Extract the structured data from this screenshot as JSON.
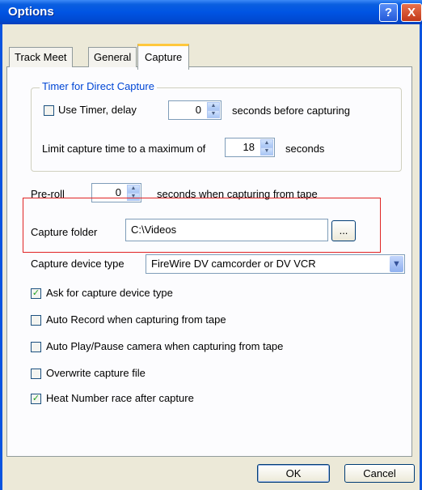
{
  "window": {
    "title": "Options"
  },
  "titlebar": {
    "help_icon": "?",
    "close_icon": "X"
  },
  "tabs": [
    {
      "label": "Track Meet"
    },
    {
      "label": "General"
    },
    {
      "label": "Capture"
    }
  ],
  "timer_group": {
    "title": "Timer for Direct Capture",
    "use_timer": {
      "label": "Use Timer, delay",
      "checked": false
    },
    "delay": {
      "value": "0",
      "suffix": "seconds before capturing"
    },
    "limit": {
      "label": "Limit capture time to a maximum of",
      "value": "18",
      "suffix": "seconds"
    }
  },
  "preroll": {
    "label": "Pre-roll",
    "value": "0",
    "suffix": "seconds when capturing from tape"
  },
  "capture_folder": {
    "label": "Capture folder",
    "value": "C:\\Videos",
    "browse_label": "..."
  },
  "capture_device": {
    "label": "Capture device type",
    "value": "FireWire DV camcorder or DV VCR"
  },
  "options": [
    {
      "label": "Ask for capture device type",
      "checked": true
    },
    {
      "label": "Auto Record when capturing from tape",
      "checked": false
    },
    {
      "label": "Auto Play/Pause camera when capturing from tape",
      "checked": false
    },
    {
      "label": "Overwrite capture file",
      "checked": false
    },
    {
      "label": "Heat Number race after capture",
      "checked": true
    }
  ],
  "buttons": {
    "ok": "OK",
    "cancel": "Cancel"
  },
  "colors": {
    "titlebar": "#0054e3",
    "highlight": "#e02424",
    "group_title": "#0046d5"
  }
}
